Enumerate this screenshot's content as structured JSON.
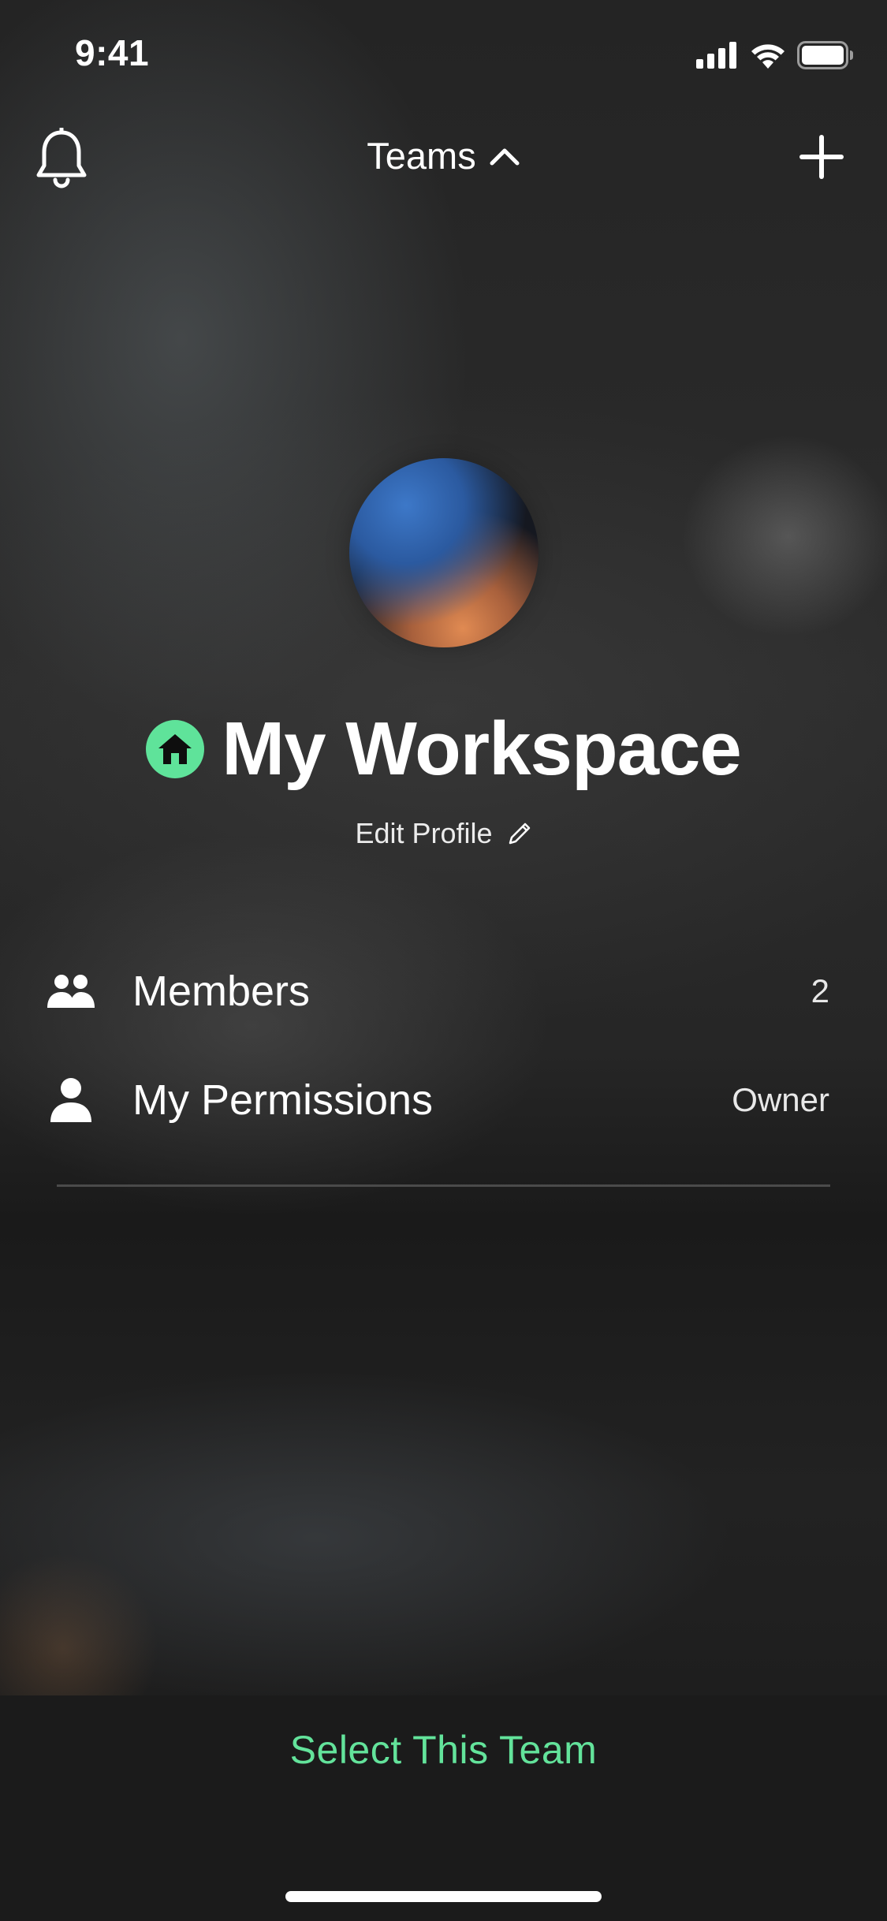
{
  "status_bar": {
    "time": "9:41",
    "icons": [
      "cellular-signal-icon",
      "wifi-icon",
      "battery-icon"
    ]
  },
  "nav": {
    "title": "Teams",
    "left_icon": "bell-icon",
    "title_icon": "chevron-up-icon",
    "right_icon": "plus-icon"
  },
  "profile": {
    "avatar": "gradient-sphere-avatar",
    "badge_icon": "home-icon",
    "badge_color": "#5fe39a",
    "name": "My Workspace",
    "edit_label": "Edit Profile",
    "edit_icon": "pencil-icon"
  },
  "list": {
    "items": [
      {
        "icon": "members-icon",
        "label": "Members",
        "value": "2"
      },
      {
        "icon": "person-icon",
        "label": "My Permissions",
        "value": "Owner"
      }
    ]
  },
  "footer": {
    "action_label": "Select This Team",
    "action_color": "#63e39b"
  }
}
